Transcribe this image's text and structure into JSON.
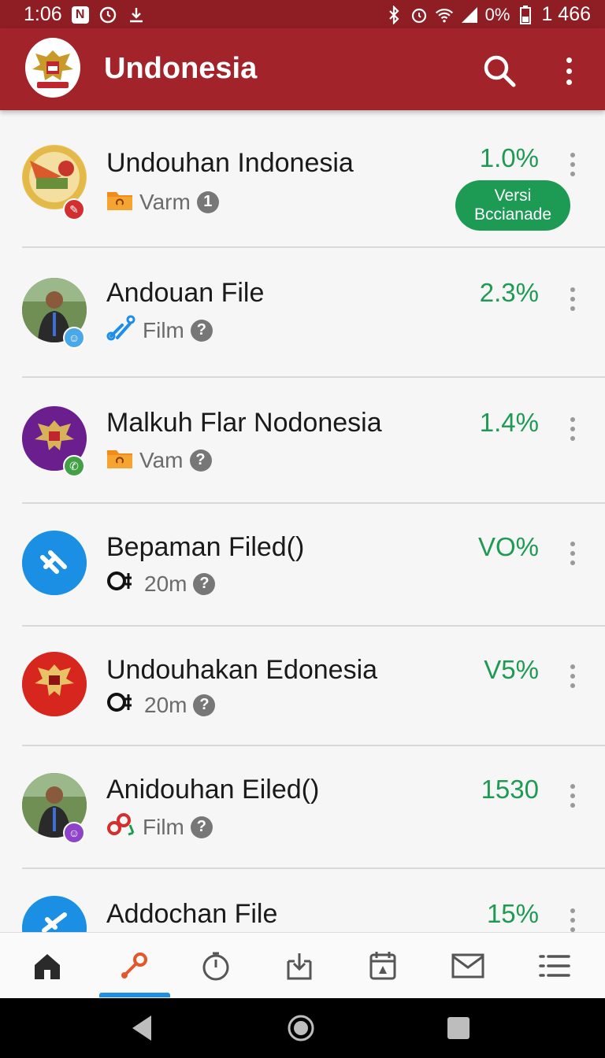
{
  "status_bar": {
    "time": "1:06",
    "battery": "0%",
    "speed": "1 466"
  },
  "app_bar": {
    "title": "Undonesia"
  },
  "items": [
    {
      "title": "Undouhan Indonesia",
      "sub_label": "Varm",
      "sub_badge": "1",
      "percent": "1.0%",
      "pill_line1": "Versi",
      "pill_line2": "Bccianade"
    },
    {
      "title": "Andouan File",
      "sub_label": "Film",
      "sub_badge": "?",
      "percent": "2.3%"
    },
    {
      "title": "Malkuh Flar Nodonesia",
      "sub_label": "Vam",
      "sub_badge": "?",
      "percent": "1.4%"
    },
    {
      "title": "Bepaman Filed()",
      "sub_label": "20m",
      "sub_badge": "?",
      "percent": "VO%"
    },
    {
      "title": "Undouhakan Edonesia",
      "sub_label": "20m",
      "sub_badge": "?",
      "percent": "V5%"
    },
    {
      "title": "Anidouhan Eiled()",
      "sub_label": "Film",
      "sub_badge": "?",
      "percent": "1530"
    },
    {
      "title": "Addochan File",
      "percent": "15%"
    }
  ],
  "colors": {
    "appbar": "#a3232b",
    "statusbar": "#8e1e24",
    "accent_green": "#1d9a53",
    "nav_indicator": "#1f8ee6"
  },
  "bottom_nav": [
    "home-icon",
    "link-icon",
    "timer-icon",
    "download-icon",
    "calendar-icon",
    "mail-icon",
    "list-icon"
  ]
}
